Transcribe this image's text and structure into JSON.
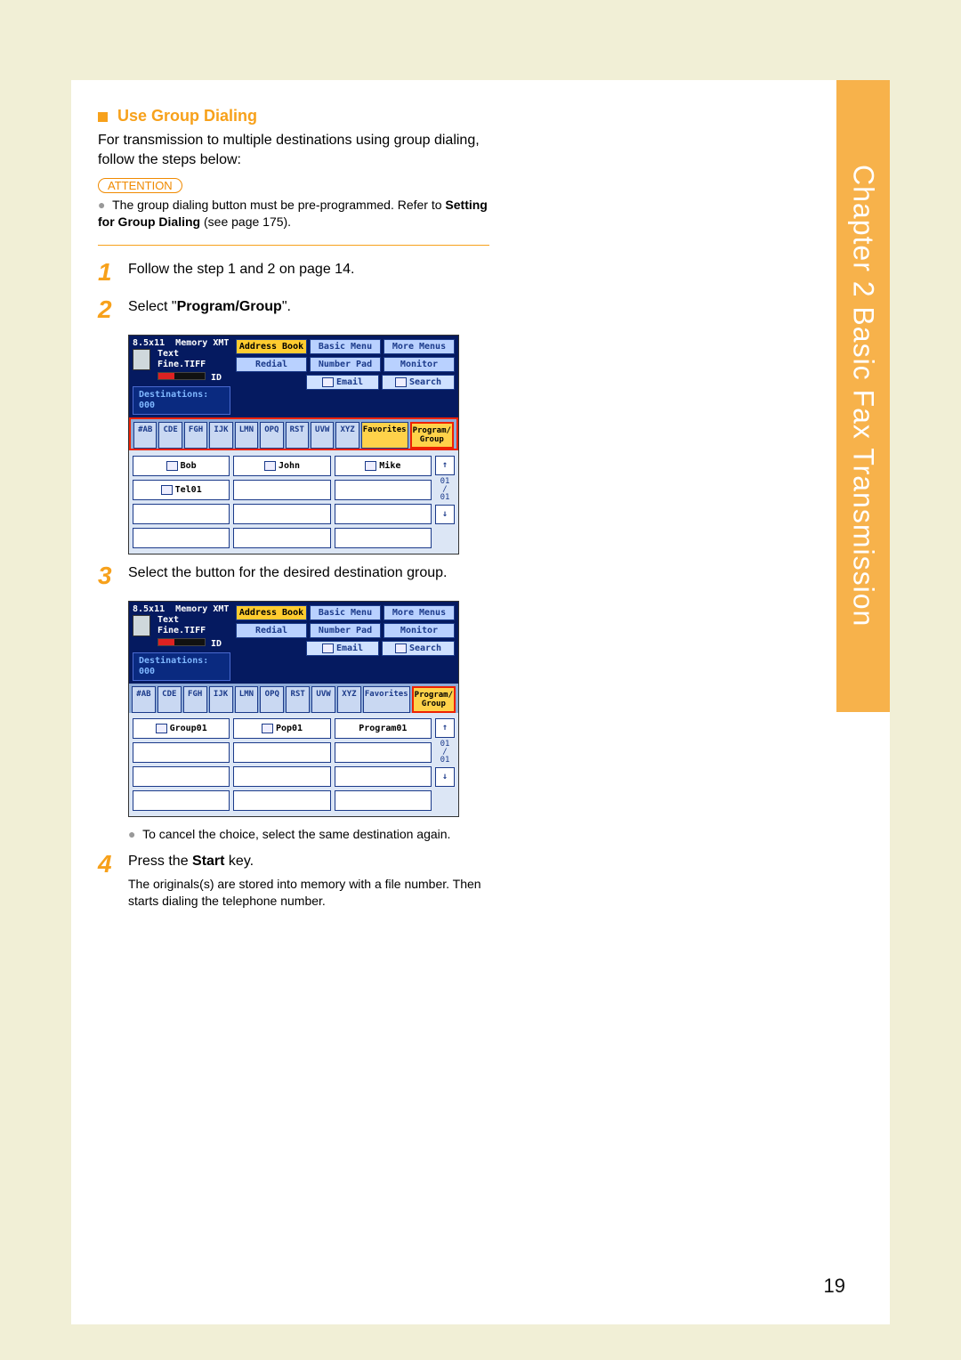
{
  "sideTab": "Chapter 2   Basic Fax Transmission",
  "section": {
    "title": "Use Group Dialing",
    "intro": "For transmission to multiple destinations using group dialing, follow the steps below:",
    "attentionLabel": "ATTENTION",
    "attentionNotePrefix": "The group dialing button must be pre-programmed. Refer to ",
    "attentionNoteBold": "Setting for Group Dialing",
    "attentionNoteSuffix": " (see page 175)."
  },
  "steps": {
    "s1": {
      "num": "1",
      "text": "Follow the step 1 and 2 on page 14."
    },
    "s2": {
      "num": "2",
      "prefix": "Select \"",
      "bold": "Program/Group",
      "suffix": "\"."
    },
    "s3": {
      "num": "3",
      "text": "Select the button for the desired destination group.",
      "sub": "To cancel the choice, select the same destination again."
    },
    "s4": {
      "num": "4",
      "prefix": "Press the ",
      "bold": "Start",
      "suffix": " key.",
      "sub": "The originals(s) are stored into memory with a file number. Then starts dialing the telephone number."
    }
  },
  "panel": {
    "hdrPaper": "8.5x11",
    "hdrMemory": "Memory XMT",
    "hdrText": "Text",
    "hdrFine": "Fine.TIFF",
    "hdrID": "ID",
    "menu": {
      "addressBook": "Address Book",
      "basicMenu": "Basic Menu",
      "moreMenus": "More Menus",
      "redial": "Redial",
      "numberPad": "Number Pad",
      "monitor": "Monitor",
      "email": "Email",
      "search": "Search"
    },
    "dest": "Destinations: 000",
    "tabs": [
      "#AB",
      "CDE",
      "FGH",
      "IJK",
      "LMN",
      "OPQ",
      "RST",
      "UVW",
      "XYZ",
      "Favorites",
      "Program/\nGroup"
    ],
    "scroll": {
      "up": "↑",
      "down": "↓",
      "ind": "01\n/\n01"
    }
  },
  "panel1Entries": {
    "row0": [
      "Bob",
      "John",
      "Mike"
    ],
    "row1": [
      "Tel01",
      "",
      ""
    ],
    "row2": [
      "",
      "",
      ""
    ],
    "row3": [
      "",
      "",
      ""
    ]
  },
  "panel2Entries": {
    "row0": [
      "Group01",
      "Pop01",
      "Program01"
    ],
    "row1": [
      "",
      "",
      ""
    ],
    "row2": [
      "",
      "",
      ""
    ],
    "row3": [
      "",
      "",
      ""
    ]
  },
  "pageNumber": "19"
}
